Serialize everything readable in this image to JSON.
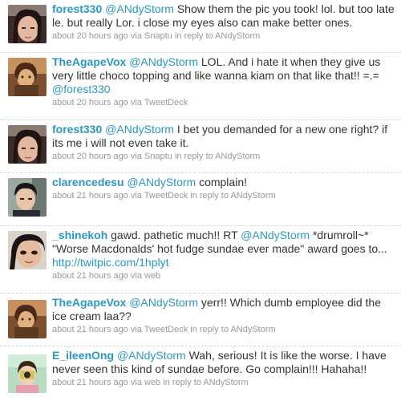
{
  "tweets": [
    {
      "username": "forest330",
      "segments": [
        {
          "kind": "mention",
          "text": "@ANdyStorm"
        },
        {
          "kind": "text",
          "text": " Show them the pic you took! lol. but too late le. but really Lor. i close my eyes also can make better ones."
        }
      ],
      "meta": {
        "time": "about 20 hours ago",
        "via_label": "via",
        "source": "Snaptu",
        "reply_prefix": "in reply to",
        "reply_to": "ANdyStorm"
      },
      "avatar_icon": "girl-selfie-avatar-icon"
    },
    {
      "username": "TheAgapeVox",
      "segments": [
        {
          "kind": "mention",
          "text": "@ANdyStorm"
        },
        {
          "kind": "text",
          "text": " LOL. And i hate it when they give us very little choco topping and like wanna kiam on that like that!! =.= "
        },
        {
          "kind": "mention",
          "text": "@forest330"
        }
      ],
      "meta": {
        "time": "about 20 hours ago",
        "via_label": "via",
        "source": "TweetDeck",
        "reply_prefix": "",
        "reply_to": ""
      },
      "avatar_icon": "sepia-portrait-avatar-icon"
    },
    {
      "username": "forest330",
      "segments": [
        {
          "kind": "mention",
          "text": "@ANdyStorm"
        },
        {
          "kind": "text",
          "text": " I bet you demanded for a new one right? if its me i will not even take it."
        }
      ],
      "meta": {
        "time": "about 20 hours ago",
        "via_label": "via",
        "source": "Snaptu",
        "reply_prefix": "in reply to",
        "reply_to": "ANdyStorm"
      },
      "avatar_icon": "girl-selfie-avatar-icon"
    },
    {
      "username": "clarencedesu",
      "segments": [
        {
          "kind": "mention",
          "text": "@ANdyStorm"
        },
        {
          "kind": "text",
          "text": " complain!"
        }
      ],
      "meta": {
        "time": "about 21 hours ago",
        "via_label": "via",
        "source": "TweetDeck",
        "reply_prefix": "in reply to",
        "reply_to": "ANdyStorm"
      },
      "avatar_icon": "boy-portrait-avatar-icon"
    },
    {
      "username": "_shinekoh",
      "segments": [
        {
          "kind": "text",
          "text": " gawd. pathetic much!! RT "
        },
        {
          "kind": "mention",
          "text": "@ANdyStorm"
        },
        {
          "kind": "text",
          "text": " *drumroll~* \"Worse Macdonalds' hot fudge sundae ever made\" award goes to... "
        },
        {
          "kind": "link",
          "text": "http://twitpic.com/1hplyt"
        }
      ],
      "meta": {
        "time": "about 21 hours ago",
        "via_label": "via",
        "source": "web",
        "reply_prefix": "",
        "reply_to": ""
      },
      "avatar_icon": "girl-closeup-avatar-icon"
    },
    {
      "username": "TheAgapeVox",
      "segments": [
        {
          "kind": "mention",
          "text": "@ANdyStorm"
        },
        {
          "kind": "text",
          "text": " yerr!! Which dumb employee did the ice cream laa??"
        }
      ],
      "meta": {
        "time": "about 21 hours ago",
        "via_label": "via",
        "source": "TweetDeck",
        "reply_prefix": "in reply to",
        "reply_to": "ANdyStorm"
      },
      "avatar_icon": "sepia-portrait-avatar-icon"
    },
    {
      "username": "E_ileenOng",
      "segments": [
        {
          "kind": "mention",
          "text": "@ANdyStorm"
        },
        {
          "kind": "text",
          "text": " Wah, serious! It is like the worse. I have never seen this kind of sundae before. Go complain!!! Hahaha!!"
        }
      ],
      "meta": {
        "time": "about 21 hours ago",
        "via_label": "via",
        "source": "web",
        "reply_prefix": "in reply to",
        "reply_to": "ANdyStorm"
      },
      "avatar_icon": "camera-girl-avatar-icon"
    }
  ],
  "colors": {
    "link": "#2b97c2",
    "text": "#333333",
    "meta": "#999999",
    "divider": "#d2dada"
  }
}
